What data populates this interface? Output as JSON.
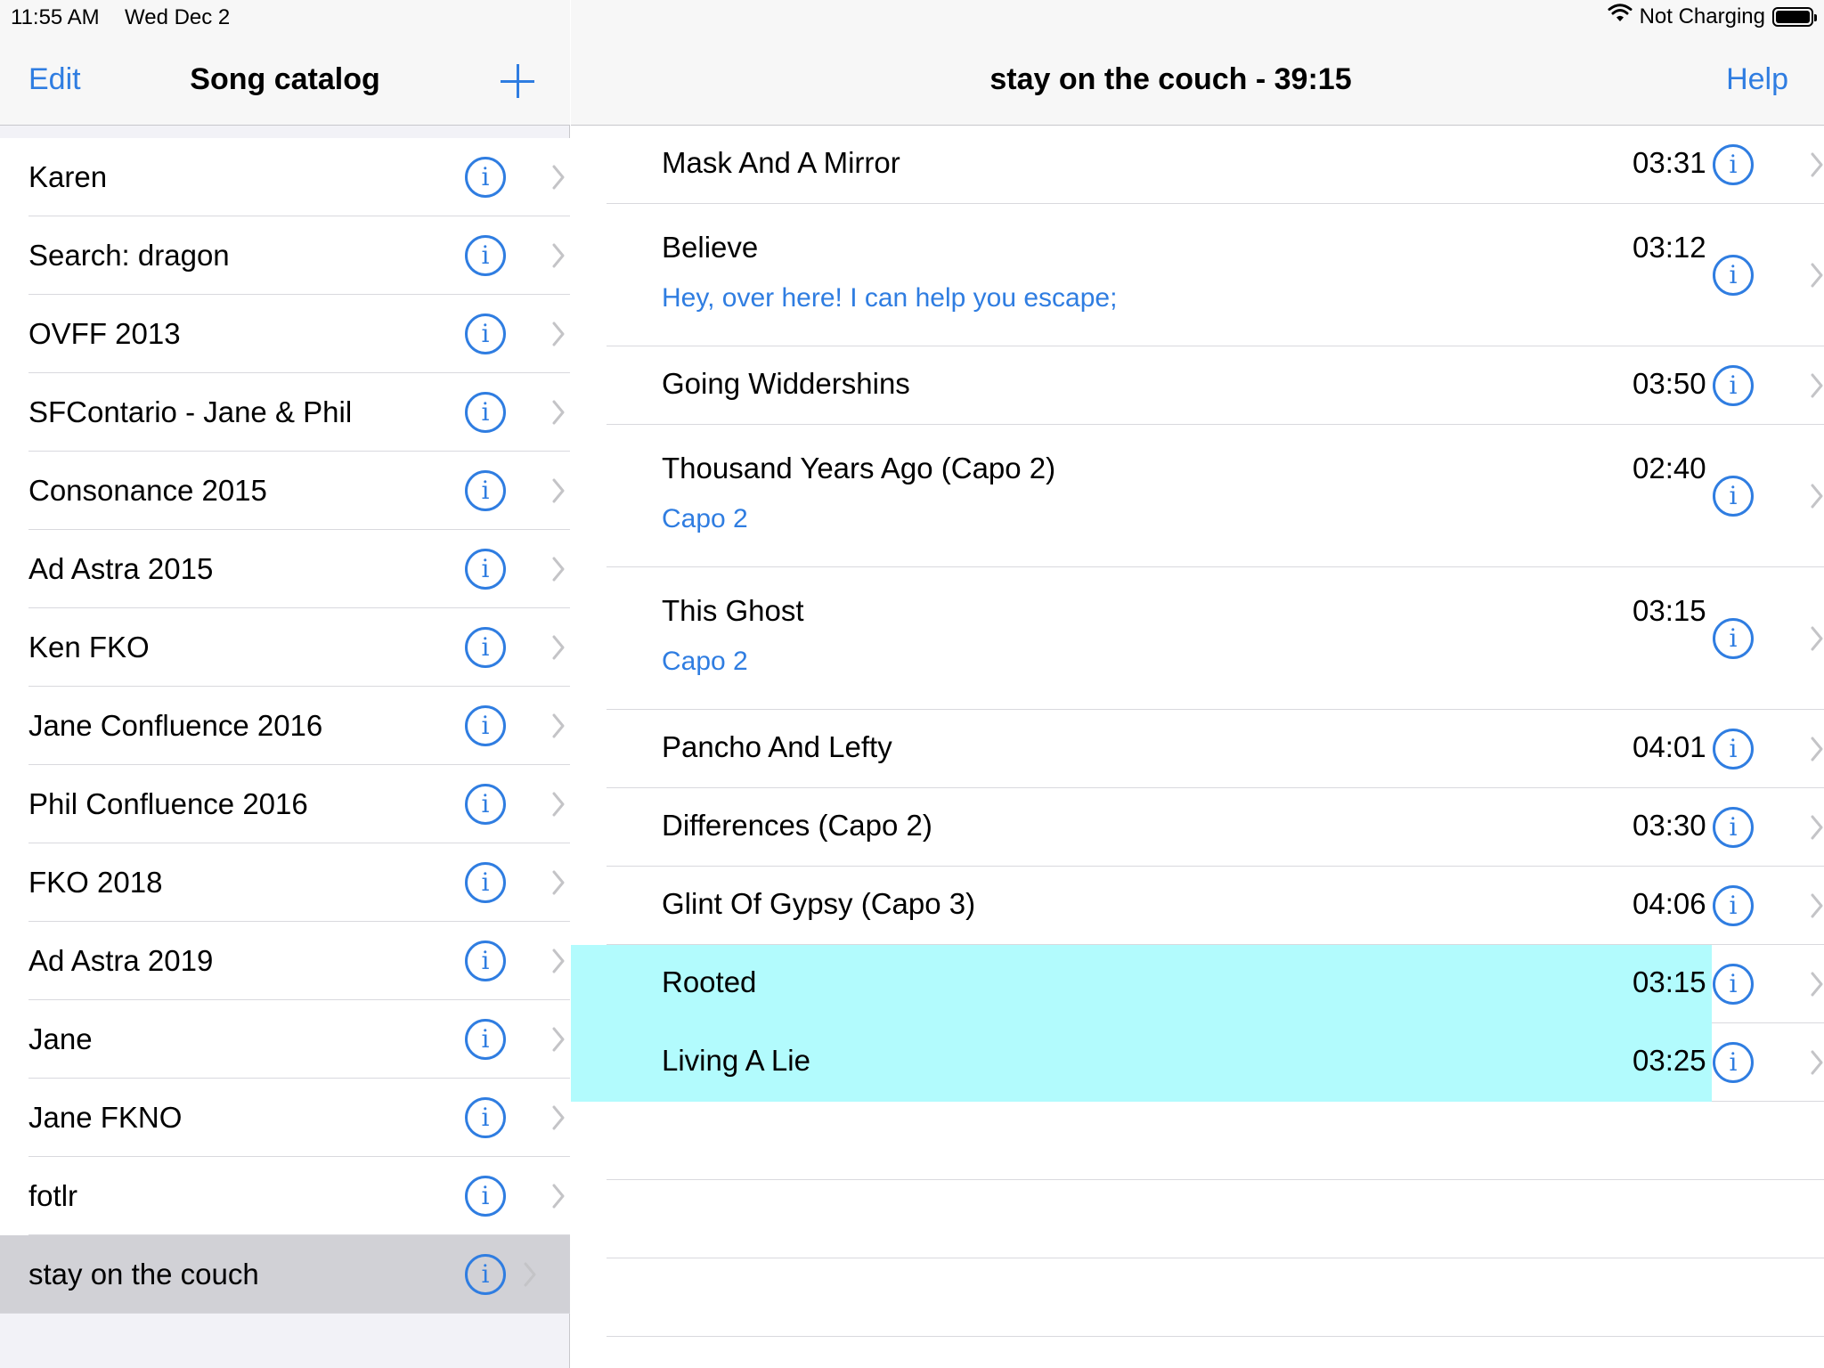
{
  "status_bar": {
    "time": "11:55 AM",
    "date": "Wed Dec 2",
    "charging": "Not Charging"
  },
  "left_nav": {
    "edit_label": "Edit",
    "title": "Song catalog",
    "add_icon": "plus-icon"
  },
  "catalog": {
    "items": [
      {
        "label": "Karen"
      },
      {
        "label": "Search: dragon"
      },
      {
        "label": "OVFF 2013"
      },
      {
        "label": "SFContario - Jane & Phil"
      },
      {
        "label": "Consonance 2015"
      },
      {
        "label": "Ad Astra 2015"
      },
      {
        "label": "Ken FKO"
      },
      {
        "label": "Jane Confluence 2016"
      },
      {
        "label": "Phil Confluence 2016"
      },
      {
        "label": "FKO 2018"
      },
      {
        "label": "Ad Astra 2019"
      },
      {
        "label": "Jane"
      },
      {
        "label": "Jane  FKNO"
      },
      {
        "label": "fotlr"
      },
      {
        "label": "stay on the couch",
        "selected": true
      }
    ]
  },
  "right_nav": {
    "title": "stay on the couch - 39:15",
    "help_label": "Help"
  },
  "songs": [
    {
      "title": "Mask And A Mirror",
      "duration": "03:31"
    },
    {
      "title": "Believe",
      "duration": "03:12",
      "note": "Hey, over here! I can help you escape;"
    },
    {
      "title": "Going Widdershins",
      "duration": "03:50"
    },
    {
      "title": "Thousand Years Ago  (Capo 2)",
      "duration": "02:40",
      "note": "Capo 2"
    },
    {
      "title": "This Ghost",
      "duration": "03:15",
      "note": "Capo 2"
    },
    {
      "title": "Pancho And Lefty",
      "duration": "04:01"
    },
    {
      "title": "Differences (Capo 2)",
      "duration": "03:30"
    },
    {
      "title": "Glint Of Gypsy (Capo 3)",
      "duration": "04:06"
    },
    {
      "title": "Rooted",
      "duration": "03:15",
      "highlighted": true
    },
    {
      "title": "Living A Lie",
      "duration": "03:25",
      "highlighted": true
    }
  ],
  "colors": {
    "accent": "#2f7de1",
    "highlight": "#b2fbfd",
    "selected_row": "#d1d1d6",
    "sidebar_bg": "#f2f2f7"
  },
  "icons": {
    "info": "i",
    "wifi": "wifi-icon",
    "battery": "battery-icon",
    "chevron": "chevron-right-icon"
  }
}
